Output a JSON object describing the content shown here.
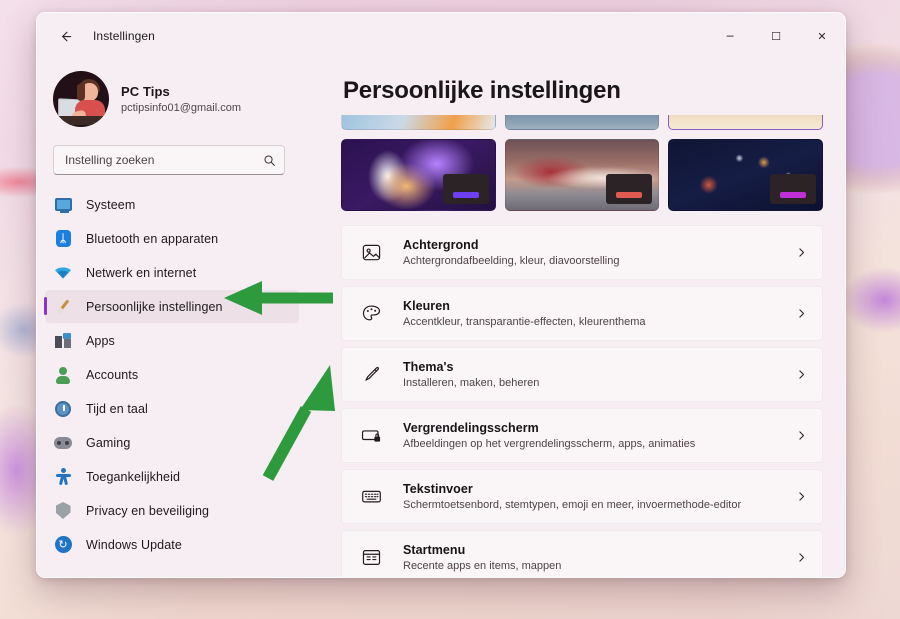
{
  "window": {
    "title": "Instellingen",
    "back_icon": "back-arrow-icon",
    "minimize_label": "─",
    "maximize_label": "☐",
    "close_label": "✕"
  },
  "account": {
    "name": "PC Tips",
    "email": "pctipsinfo01@gmail.com",
    "avatar_icon": "user-avatar"
  },
  "search": {
    "placeholder": "Instelling zoeken",
    "value": "",
    "icon": "search-icon"
  },
  "sidebar": {
    "items": [
      {
        "label": "Systeem",
        "icon": "monitor-icon",
        "selected": false
      },
      {
        "label": "Bluetooth en apparaten",
        "icon": "bluetooth-icon",
        "selected": false
      },
      {
        "label": "Netwerk en internet",
        "icon": "wifi-icon",
        "selected": false
      },
      {
        "label": "Persoonlijke instellingen",
        "icon": "paintbrush-icon",
        "selected": true
      },
      {
        "label": "Apps",
        "icon": "apps-icon",
        "selected": false
      },
      {
        "label": "Accounts",
        "icon": "account-icon",
        "selected": false
      },
      {
        "label": "Tijd en taal",
        "icon": "clock-icon",
        "selected": false
      },
      {
        "label": "Gaming",
        "icon": "gamepad-icon",
        "selected": false
      },
      {
        "label": "Toegankelijkheid",
        "icon": "accessibility-icon",
        "selected": false
      },
      {
        "label": "Privacy en beveiliging",
        "icon": "shield-icon",
        "selected": false
      },
      {
        "label": "Windows Update",
        "icon": "update-icon",
        "selected": false
      }
    ]
  },
  "main": {
    "page_title": "Persoonlijke instellingen",
    "themes": [
      {
        "name": "theme-thumbnail-light-1",
        "clipped": true,
        "style": "th-d",
        "pill": "#5b3fd6"
      },
      {
        "name": "theme-thumbnail-light-2",
        "clipped": true,
        "style": "th-e",
        "pill": "#e05a5a"
      },
      {
        "name": "theme-thumbnail-light-3",
        "clipped": true,
        "style": "th-f",
        "pill": "#b832d6"
      },
      {
        "name": "theme-thumbnail-dark-1",
        "clipped": false,
        "style": "th-a",
        "pill": "#6d3ff0"
      },
      {
        "name": "theme-thumbnail-dark-2",
        "clipped": false,
        "style": "th-b",
        "pill": "#e05a52"
      },
      {
        "name": "theme-thumbnail-dark-3",
        "clipped": false,
        "style": "th-c",
        "pill": "#c02fd8"
      }
    ],
    "rows": [
      {
        "title": "Achtergrond",
        "subtitle": "Achtergrondafbeelding, kleur, diavoorstelling",
        "icon": "image-icon"
      },
      {
        "title": "Kleuren",
        "subtitle": "Accentkleur, transparantie-effecten, kleurenthema",
        "icon": "palette-icon"
      },
      {
        "title": "Thema's",
        "subtitle": "Installeren, maken, beheren",
        "icon": "brush-icon"
      },
      {
        "title": "Vergrendelingsscherm",
        "subtitle": "Afbeeldingen op het vergrendelingsscherm, apps, animaties",
        "icon": "lockscreen-icon"
      },
      {
        "title": "Tekstinvoer",
        "subtitle": "Schermtoetsenbord, stemtypen, emoji en meer, invoermethode-editor",
        "icon": "keyboard-icon"
      },
      {
        "title": "Startmenu",
        "subtitle": "Recente apps en items, mappen",
        "icon": "startmenu-icon"
      }
    ],
    "chevron_icon": "chevron-right-icon"
  },
  "annotations": {
    "color": "#2d9a3e",
    "arrows": [
      {
        "name": "arrow-to-persoonlijke-instellingen",
        "target": "Persoonlijke instellingen"
      },
      {
        "name": "arrow-to-themas",
        "target": "Thema's"
      }
    ]
  },
  "colors": {
    "accent_purple": "#8b33c7",
    "window_bg": "#f6eef2",
    "row_bg": "#faf5f7",
    "annotation_green": "#2d9a3e"
  }
}
